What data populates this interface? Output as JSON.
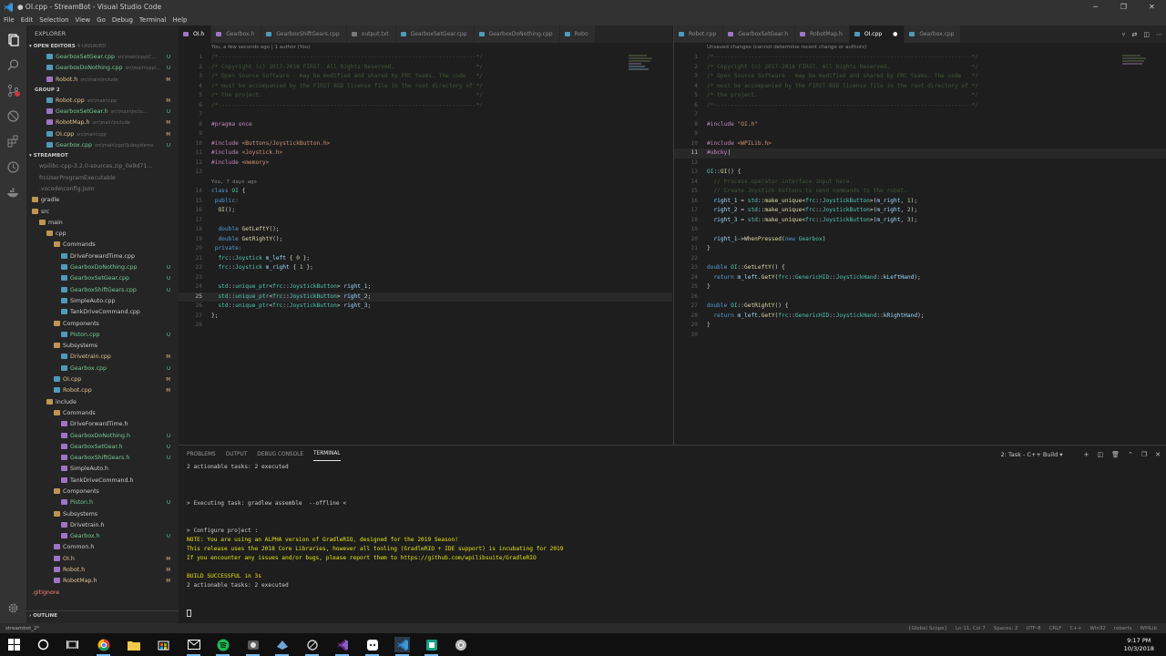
{
  "window": {
    "title": "● OI.cpp - StreamBot - Visual Studio Code",
    "controls": [
      "─",
      "❐",
      "✕"
    ]
  },
  "menu": [
    "File",
    "Edit",
    "Selection",
    "View",
    "Go",
    "Debug",
    "Terminal",
    "Help"
  ],
  "sidebar": {
    "title": "EXPLORER",
    "open_editors_label": "OPEN EDITORS",
    "open_editors_hint": "4 UNSAVED",
    "group2_label": "GROUP 2",
    "streambot_label": "STREAMBOT",
    "outline_label": "OUTLINE",
    "open_editors": [
      {
        "name": "GearboxSetGear.cpp",
        "desc": "src\\main\\cpp\\C...",
        "badge": "U",
        "type": "cpp"
      },
      {
        "name": "GearboxDoNothing.cpp",
        "desc": "src\\main\\cpp\\...",
        "badge": "U",
        "type": "cpp"
      },
      {
        "name": "Robot.h",
        "desc": "src\\main\\include",
        "badge": "M",
        "type": "h"
      }
    ],
    "group2": [
      {
        "name": "Robot.cpp",
        "desc": "src\\main\\cpp",
        "badge": "M",
        "type": "cpp"
      },
      {
        "name": "GearboxSetGear.h",
        "desc": "src\\main\\inclu...",
        "badge": "U",
        "type": "h"
      },
      {
        "name": "RobotMap.h",
        "desc": "src\\main\\include",
        "badge": "M",
        "type": "h"
      },
      {
        "name": "OI.cpp",
        "desc": "src\\main\\cpp",
        "badge": "M",
        "type": "cpp"
      },
      {
        "name": "Gearbox.cpp",
        "desc": "src\\main\\cpp\\Subsystems",
        "badge": "U",
        "type": "cpp"
      }
    ],
    "tree": [
      {
        "name": "wpilibc-cpp-3.2.0-sources.zip_0e9d71...",
        "indent": 1,
        "type": "dim",
        "badge": ""
      },
      {
        "name": "frcUserProgramExecutable",
        "indent": 1,
        "type": "dim",
        "badge": ""
      },
      {
        "name": ".vscode\\config.json",
        "indent": 1,
        "type": "dim",
        "badge": ""
      },
      {
        "name": "gradle",
        "indent": 0,
        "type": "folder",
        "badge": ""
      },
      {
        "name": "src",
        "indent": 0,
        "type": "folder",
        "badge": ""
      },
      {
        "name": "main",
        "indent": 1,
        "type": "folder",
        "badge": ""
      },
      {
        "name": "cpp",
        "indent": 2,
        "type": "folder",
        "badge": ""
      },
      {
        "name": "Commands",
        "indent": 3,
        "type": "folder",
        "badge": ""
      },
      {
        "name": "DriveForwardTime.cpp",
        "indent": 4,
        "type": "cpp",
        "badge": ""
      },
      {
        "name": "GearboxDoNothing.cpp",
        "indent": 4,
        "type": "cpp",
        "badge": "U"
      },
      {
        "name": "GearboxSetGear.cpp",
        "indent": 4,
        "type": "cpp",
        "badge": "U"
      },
      {
        "name": "GearboxShiftGears.cpp",
        "indent": 4,
        "type": "cpp",
        "badge": "U"
      },
      {
        "name": "SimpleAuto.cpp",
        "indent": 4,
        "type": "cpp",
        "badge": ""
      },
      {
        "name": "TankDriveCommand.cpp",
        "indent": 4,
        "type": "cpp",
        "badge": ""
      },
      {
        "name": "Components",
        "indent": 3,
        "type": "folder",
        "badge": ""
      },
      {
        "name": "Piston.cpp",
        "indent": 4,
        "type": "cpp",
        "badge": "U"
      },
      {
        "name": "Subsystems",
        "indent": 3,
        "type": "folder",
        "badge": ""
      },
      {
        "name": "Drivetrain.cpp",
        "indent": 4,
        "type": "cpp",
        "badge": "M"
      },
      {
        "name": "Gearbox.cpp",
        "indent": 4,
        "type": "cpp",
        "badge": "U"
      },
      {
        "name": "OI.cpp",
        "indent": 3,
        "type": "cpp",
        "badge": "M"
      },
      {
        "name": "Robot.cpp",
        "indent": 3,
        "type": "cpp",
        "badge": "M"
      },
      {
        "name": "include",
        "indent": 2,
        "type": "folder",
        "badge": ""
      },
      {
        "name": "Commands",
        "indent": 3,
        "type": "folder",
        "badge": ""
      },
      {
        "name": "DriveForwardTime.h",
        "indent": 4,
        "type": "h",
        "badge": ""
      },
      {
        "name": "GearboxDoNothing.h",
        "indent": 4,
        "type": "h",
        "badge": "U"
      },
      {
        "name": "GearboxSetGear.h",
        "indent": 4,
        "type": "h",
        "badge": "U"
      },
      {
        "name": "GearboxShiftGears.h",
        "indent": 4,
        "type": "h",
        "badge": "U"
      },
      {
        "name": "SimpleAuto.h",
        "indent": 4,
        "type": "h",
        "badge": ""
      },
      {
        "name": "TankDriveCommand.h",
        "indent": 4,
        "type": "h",
        "badge": ""
      },
      {
        "name": "Components",
        "indent": 3,
        "type": "folder",
        "badge": ""
      },
      {
        "name": "Piston.h",
        "indent": 4,
        "type": "h",
        "badge": "U"
      },
      {
        "name": "Subsystems",
        "indent": 3,
        "type": "folder",
        "badge": ""
      },
      {
        "name": "Drivetrain.h",
        "indent": 4,
        "type": "h",
        "badge": ""
      },
      {
        "name": "Gearbox.h",
        "indent": 4,
        "type": "h",
        "badge": "U"
      },
      {
        "name": "Common.h",
        "indent": 3,
        "type": "h",
        "badge": ""
      },
      {
        "name": "OI.h",
        "indent": 3,
        "type": "h",
        "badge": "M"
      },
      {
        "name": "Robot.h",
        "indent": 3,
        "type": "h",
        "badge": "M"
      },
      {
        "name": "RobotMap.h",
        "indent": 3,
        "type": "h",
        "badge": "M"
      },
      {
        "name": ".gitignore",
        "indent": 0,
        "type": "red",
        "badge": ""
      }
    ]
  },
  "editor_left": {
    "tabs": [
      {
        "label": "OI.h",
        "active": true,
        "type": "h"
      },
      {
        "label": "Gearbox.h",
        "active": false,
        "type": "h"
      },
      {
        "label": "GearboxShiftGears.cpp",
        "active": false,
        "type": "cpp"
      },
      {
        "label": "output.txt",
        "active": false,
        "type": "txt"
      },
      {
        "label": "GearboxSetGear.cpp",
        "active": false,
        "type": "cpp"
      },
      {
        "label": "GearboxDoNothing.cpp",
        "active": false,
        "type": "cpp"
      },
      {
        "label": "Robo",
        "active": false,
        "type": "cpp"
      }
    ],
    "blame": "You, a few seconds ago | 1 author (You)",
    "lens": "You, 7 days ago"
  },
  "editor_right": {
    "tabs": [
      {
        "label": "Robot.cpp",
        "active": false,
        "type": "cpp"
      },
      {
        "label": "GearboxSetGear.h",
        "active": false,
        "type": "h"
      },
      {
        "label": "RobotMap.h",
        "active": false,
        "type": "h"
      },
      {
        "label": "OI.cpp",
        "active": true,
        "type": "cpp"
      },
      {
        "label": "Gearbox.cpp",
        "active": false,
        "type": "cpp"
      }
    ],
    "blame": "Unsaved changes (cannot determine recent change or authors)"
  },
  "panel": {
    "tabs": [
      "PROBLEMS",
      "OUTPUT",
      "DEBUG CONSOLE",
      "TERMINAL"
    ],
    "active_tab": "TERMINAL",
    "task_select": "2: Task - C++ Build",
    "lines": [
      {
        "text": "2 actionable tasks: 2 executed",
        "style": ""
      },
      {
        "text": "",
        "style": "blank"
      },
      {
        "text": "",
        "style": "blank"
      },
      {
        "text": "",
        "style": "blank"
      },
      {
        "text": "> Executing task: gradlew assemble  --offline <",
        "style": ""
      },
      {
        "text": "",
        "style": "blank"
      },
      {
        "text": "",
        "style": "blank"
      },
      {
        "text": "> Configure project :",
        "style": ""
      },
      {
        "text": "NOTE: You are using an ALPHA version of GradleRIO, designed for the 2019 Season!",
        "style": "y"
      },
      {
        "text": "This release uses the 2018 Core Libraries, however all tooling (GradleRIO + IDE support) is incubating for 2019",
        "style": "y"
      },
      {
        "text": "If you encounter any issues and/or bugs, please report them to https://github.com/wpilibsuite/GradleRIO",
        "style": "y"
      },
      {
        "text": "",
        "style": "blank"
      },
      {
        "text": "BUILD SUCCESSFUL in 3s",
        "style": "y"
      },
      {
        "text": "2 actionable tasks: 2 executed",
        "style": ""
      }
    ]
  },
  "statusbar": {
    "left": "streambot_2*",
    "right": [
      "{Global Scope}",
      "Ln 11, Col 7",
      "Spaces: 2",
      "UTF-8",
      "CRLF",
      "C++",
      "Win32",
      "roberts",
      "WPILib"
    ]
  },
  "taskbar": {
    "time": "9:17 PM",
    "date": "10/3/2018"
  }
}
